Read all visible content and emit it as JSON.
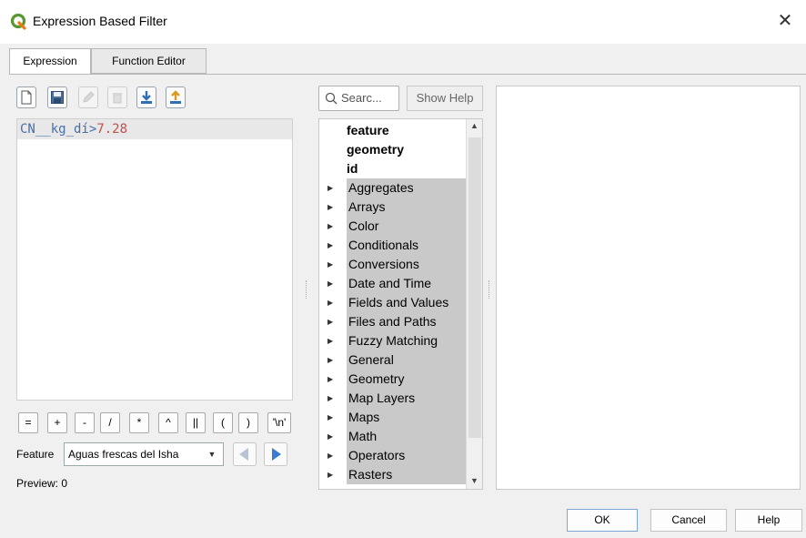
{
  "window": {
    "title": "Expression Based Filter"
  },
  "tabs": [
    {
      "label": "Expression"
    },
    {
      "label": "Function Editor"
    }
  ],
  "editor": {
    "expression": {
      "field": "CN__kg_dí",
      "operator": ">",
      "number": "7.28"
    }
  },
  "operators": [
    "=",
    "+",
    "-",
    "/",
    "*",
    "^",
    "||",
    "(",
    ")",
    "'\\n'"
  ],
  "feature": {
    "label": "Feature",
    "value": "Aguas frescas del Isha"
  },
  "preview": {
    "text": "Preview: 0"
  },
  "search": {
    "placeholder": "Searc..."
  },
  "show_help": "Show Help",
  "tree": {
    "plain_items": [
      "feature",
      "geometry",
      "id"
    ],
    "groups": [
      "Aggregates",
      "Arrays",
      "Color",
      "Conditionals",
      "Conversions",
      "Date and Time",
      "Fields and Values",
      "Files and Paths",
      "Fuzzy Matching",
      "General",
      "Geometry",
      "Map Layers",
      "Maps",
      "Math",
      "Operators",
      "Rasters"
    ]
  },
  "buttons": {
    "ok": "OK",
    "cancel": "Cancel",
    "help": "Help"
  },
  "colors": {
    "accent": "#3a7bd5",
    "qgis_green": "#589632",
    "qgis_yellow": "#ee7913"
  }
}
